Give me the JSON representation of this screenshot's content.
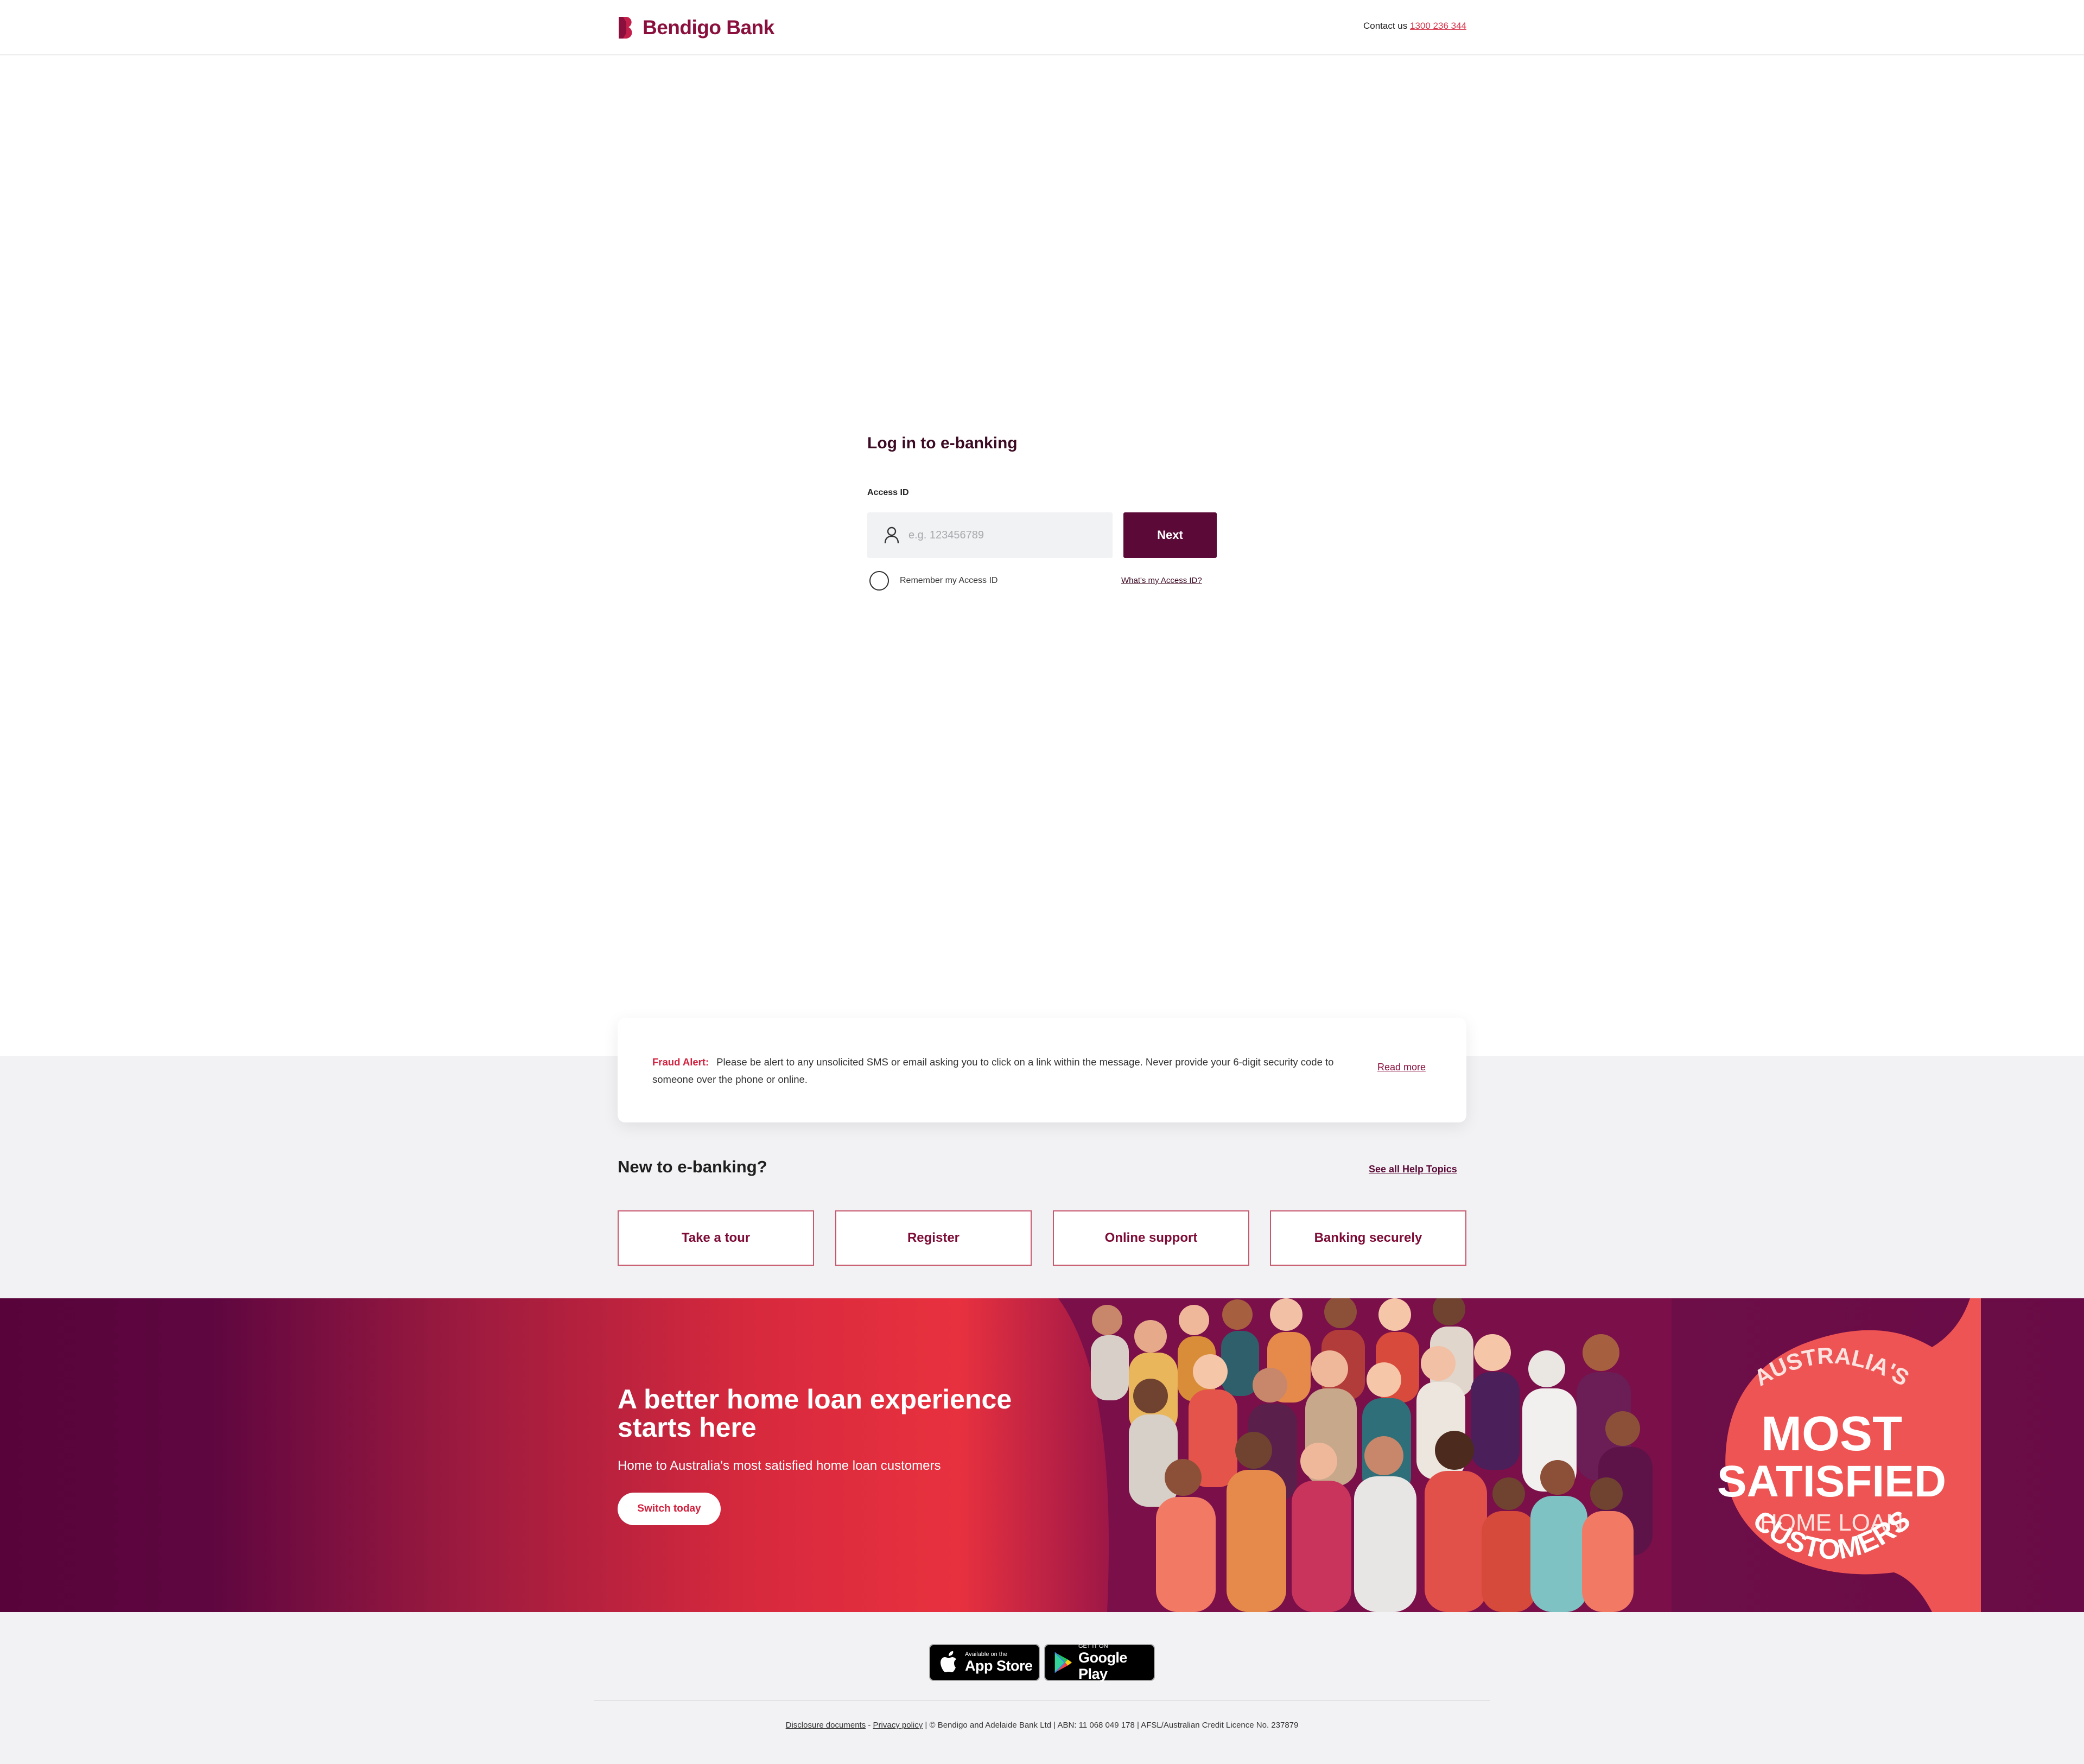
{
  "header": {
    "brand": "Bendigo Bank",
    "contact_label": "Contact us",
    "contact_phone": "1300 236 344"
  },
  "login": {
    "title": "Log in to e-banking",
    "access_id_label": "Access ID",
    "access_id_placeholder": "e.g. 123456789",
    "next_label": "Next",
    "remember_label": "Remember my Access ID",
    "whats_id_link": "What's my Access ID?"
  },
  "alert": {
    "prefix": "Fraud Alert:",
    "message": "Please be alert to any unsolicited SMS or email asking you to click on a link within the message. Never provide your 6-digit security code to someone over the phone or online.",
    "read_more": "Read more"
  },
  "help": {
    "title": "New to e-banking?",
    "see_all": "See all Help Topics",
    "tiles": [
      "Take a tour",
      "Register",
      "Online support",
      "Banking securely"
    ]
  },
  "banner": {
    "title": "A better home loan experience starts here",
    "subtitle": "Home to Australia's most satisfied home loan customers",
    "cta": "Switch today",
    "badge_lines": [
      "AUSTRALIA'S",
      "MOST",
      "SATISFIED",
      "HOME LOAN",
      "CUSTOMERS"
    ]
  },
  "footer": {
    "appstore_small": "Available on the",
    "appstore_big": "App Store",
    "googleplay_small": "GET IT ON",
    "googleplay_big": "Google Play",
    "disclosure": "Disclosure documents",
    "privacy": "Privacy policy",
    "legal": "| © Bendigo and Adelaide Bank Ltd | ABN: 11 068 049 178 | AFSL/Australian Credit Licence No. 237879"
  },
  "colors": {
    "brand": "#8a0f3d",
    "button": "#5b0a37",
    "alert": "#d21f3c",
    "tile_border": "#c6596d"
  }
}
